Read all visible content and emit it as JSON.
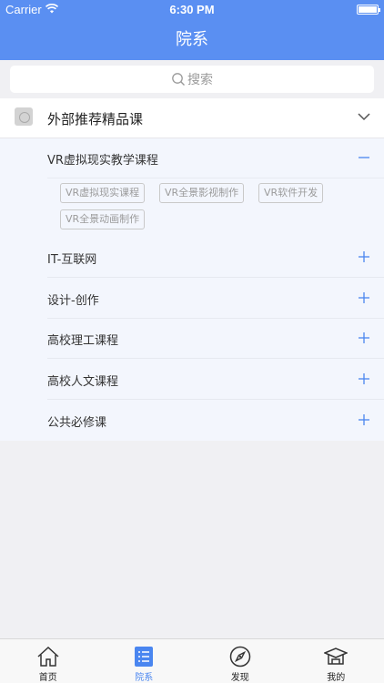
{
  "status_bar": {
    "carrier": "Carrier",
    "time": "6:30 PM"
  },
  "nav": {
    "title": "院系"
  },
  "search": {
    "placeholder": "搜索"
  },
  "group": {
    "title": "外部推荐精品课"
  },
  "categories": [
    {
      "label": "VR虚拟现实教学课程",
      "expanded": true
    },
    {
      "label": "IT-互联网",
      "expanded": false
    },
    {
      "label": "设计-创作",
      "expanded": false
    },
    {
      "label": "高校理工课程",
      "expanded": false
    },
    {
      "label": "高校人文课程",
      "expanded": false
    },
    {
      "label": "公共必修课",
      "expanded": false
    }
  ],
  "tags": [
    "VR虚拟现实课程",
    "VR全景影视制作",
    "VR软件开发",
    "VR全景动画制作"
  ],
  "tabs": [
    {
      "label": "首页",
      "icon": "home-icon",
      "active": false
    },
    {
      "label": "院系",
      "icon": "list-icon",
      "active": true
    },
    {
      "label": "发现",
      "icon": "compass-icon",
      "active": false
    },
    {
      "label": "我的",
      "icon": "graduation-cap-icon",
      "active": false
    }
  ],
  "colors": {
    "primary": "#5a8ff2",
    "accent": "#4a86f0",
    "sub_bg": "#f3f6fd"
  }
}
